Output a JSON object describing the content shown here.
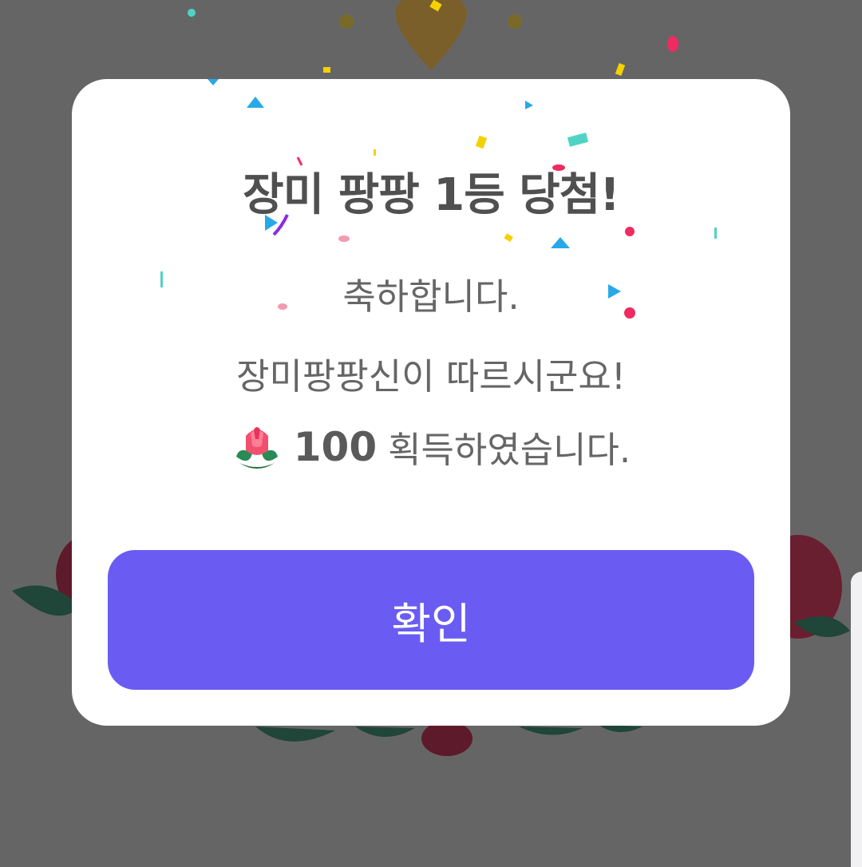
{
  "dialog": {
    "title": "장미 팡팡 1등 당첨!",
    "line1": "축하합니다.",
    "line2": "장미팡팡신이 따르시군요!",
    "reward_icon": "rose-icon",
    "reward_amount": "100",
    "reward_suffix": "획득하였습니다.",
    "confirm_label": "확인"
  },
  "colors": {
    "overlay": "#666566",
    "modal": "#ffffff",
    "primary_button": "#6a5cf2",
    "title_text": "#505050",
    "body_text": "#666666"
  }
}
